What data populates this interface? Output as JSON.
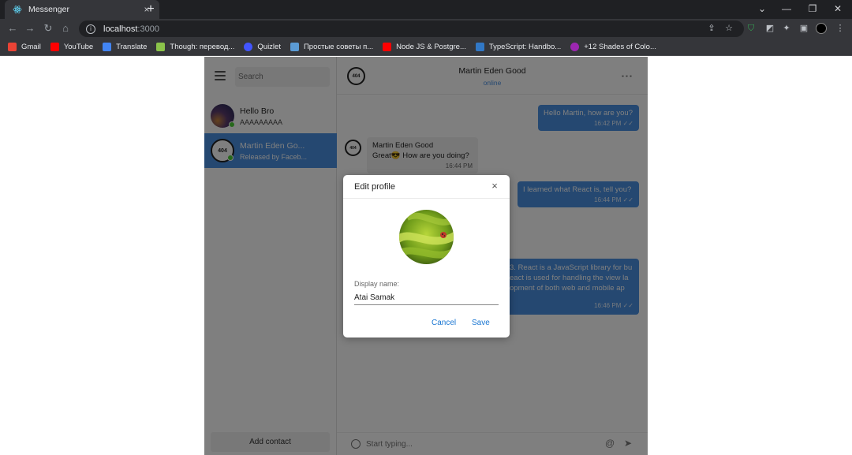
{
  "browser": {
    "tab_title": "Messenger",
    "tab_close": "×",
    "new_tab": "+",
    "url_host": "localhost",
    "url_port": ":3000",
    "bookmarks": [
      {
        "label": "Gmail",
        "color": "#ea4335"
      },
      {
        "label": "YouTube",
        "color": "#ff0000"
      },
      {
        "label": "Translate",
        "color": "#4285f4"
      },
      {
        "label": "Though: перевод...",
        "color": "#8bc34a"
      },
      {
        "label": "Quizlet",
        "color": "#4255ff"
      },
      {
        "label": "Простые советы п...",
        "color": "#5b9bd5"
      },
      {
        "label": "Node JS & Postgre...",
        "color": "#ff0000"
      },
      {
        "label": "TypeScript: Handbo...",
        "color": "#3178c6"
      },
      {
        "label": "+12 Shades of Colo...",
        "color": "#9c27b0"
      }
    ]
  },
  "sidebar": {
    "search_placeholder": "Search",
    "chats": [
      {
        "name": "Hello Bro",
        "last": "AAAAAAAAA",
        "online": true
      },
      {
        "name": "Martin Eden Go...",
        "last": "Released by Faceb...",
        "online": true,
        "active": true,
        "avatar_text": "404"
      }
    ],
    "add_contact_label": "Add contact"
  },
  "chat": {
    "header_name": "Martin Eden Good",
    "header_status": "online",
    "avatar_text": "404",
    "menu_icon": "⋮",
    "messages": [
      {
        "dir": "out",
        "text": "Hello Martin, how are you?",
        "time": "16:42 PM"
      },
      {
        "dir": "in",
        "author": "Martin Eden Good",
        "text": "Great😎 How are you doing?",
        "time": "16:44 PM"
      },
      {
        "dir": "out",
        "text": "I learned what React is, tell you?",
        "time": "16:44 PM"
      },
      {
        "dir": "out",
        "lines": [
          "3. React is a JavaScript library for bu",
          "eact is used for handling the view la",
          "opment of both web and mobile ap"
        ],
        "time": "16:46 PM"
      }
    ],
    "composer_placeholder": "Start typing..."
  },
  "dialog": {
    "title": "Edit profile",
    "close_icon": "×",
    "field_label": "Display name:",
    "field_value": "Atai Samak",
    "cancel_label": "Cancel",
    "save_label": "Save"
  },
  "colors": {
    "accent": "#4a90e2",
    "online": "#4cd137",
    "dialog_button": "#1976d2"
  }
}
